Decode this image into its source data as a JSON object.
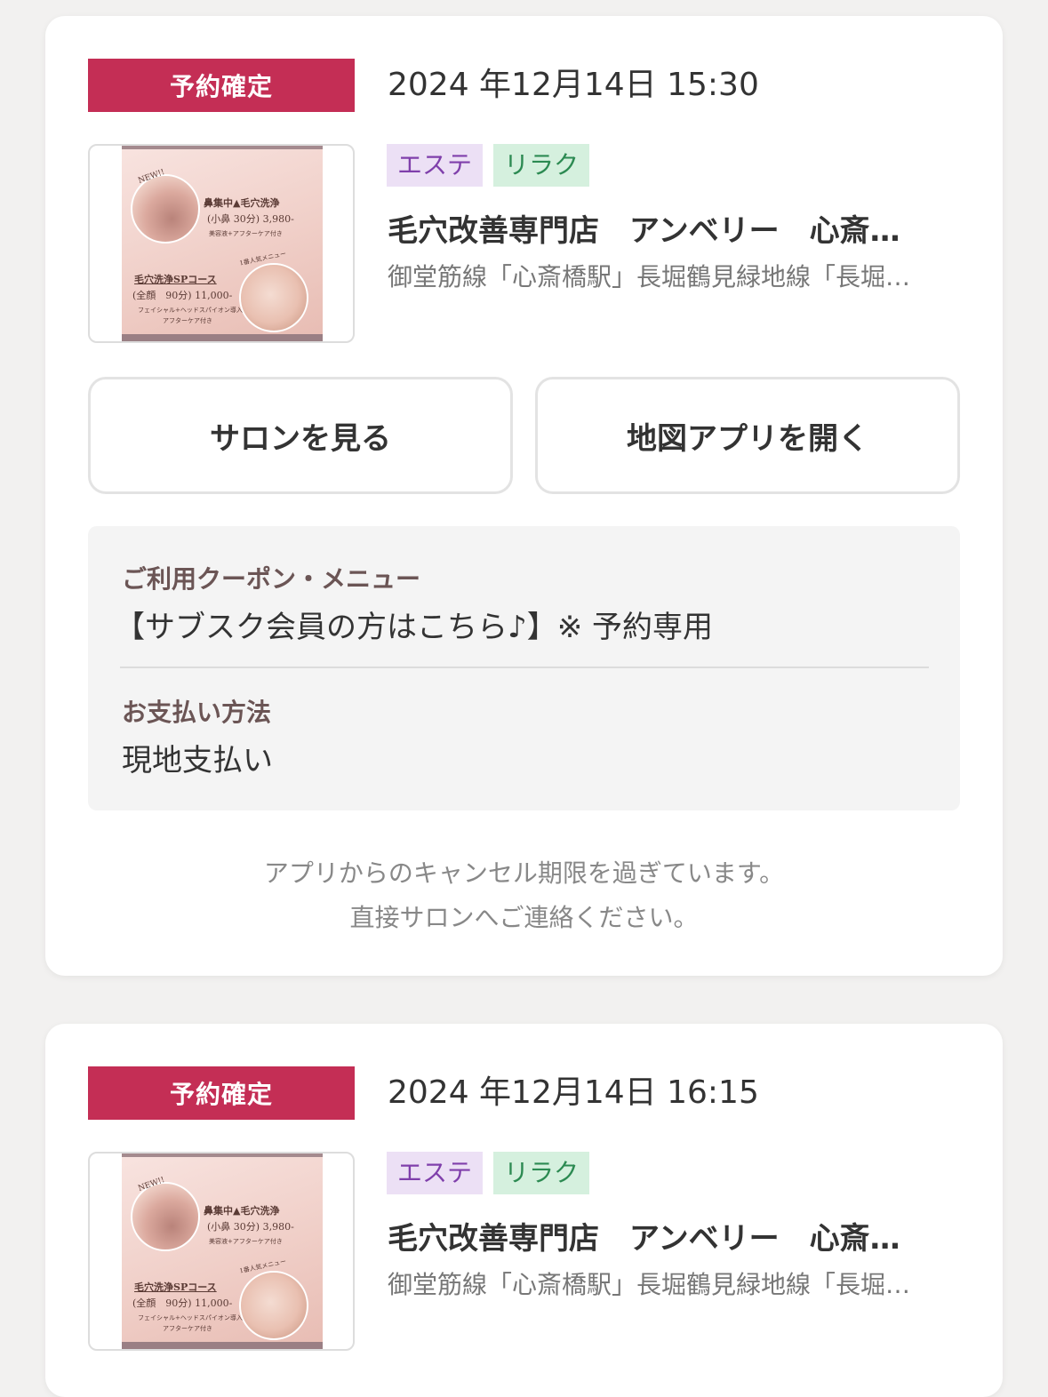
{
  "reservations": [
    {
      "status": "予約確定",
      "datetime": "2024 年12月14日 15:30",
      "tags": [
        "エステ",
        "リラク"
      ],
      "salon_name": "毛穴改善専門店　アンベリー　心斎…",
      "access": "御堂筋線「心斎橋駅」長堀鶴見緑地線「長堀…",
      "thumbnail": {
        "new": "NEW!!",
        "line1": "鼻集中▲毛穴洗浄",
        "line2": "(小鼻 30分) 3,980-",
        "line3": "美容液+アフターケア付き",
        "line4": "1番人気メニュー",
        "line5": "毛穴洗浄SPコース",
        "line6": "(全顔　90分) 11,000-",
        "line7": "フェイシャル+ヘッドスパイオン導入",
        "line8": "アフターケア付き"
      },
      "buttons": {
        "salon": "サロンを見る",
        "map": "地図アプリを開く"
      },
      "coupon_label": "ご利用クーポン・メニュー",
      "coupon_value": "【サブスク会員の方はこちら♪】※ 予約専用",
      "payment_label": "お支払い方法",
      "payment_value": "現地支払い",
      "cancel_note_1": "アプリからのキャンセル期限を過ぎています。",
      "cancel_note_2": "直接サロンへご連絡ください。"
    },
    {
      "status": "予約確定",
      "datetime": "2024 年12月14日 16:15",
      "tags": [
        "エステ",
        "リラク"
      ],
      "salon_name": "毛穴改善専門店　アンベリー　心斎…",
      "access": "御堂筋線「心斎橋駅」長堀鶴見緑地線「長堀…",
      "thumbnail": {
        "new": "NEW!!",
        "line1": "鼻集中▲毛穴洗浄",
        "line2": "(小鼻 30分) 3,980-",
        "line3": "美容液+アフターケア付き",
        "line4": "1番人気メニュー",
        "line5": "毛穴洗浄SPコース",
        "line6": "(全顔　90分) 11,000-",
        "line7": "フェイシャル+ヘッドスパイオン導入",
        "line8": "アフターケア付き"
      }
    }
  ],
  "colors": {
    "badge": "#c42e55",
    "tag_este_bg": "#ece0f5",
    "tag_este_text": "#7f3fab",
    "tag_relax_bg": "#d5f0de",
    "tag_relax_text": "#2c8a52"
  }
}
